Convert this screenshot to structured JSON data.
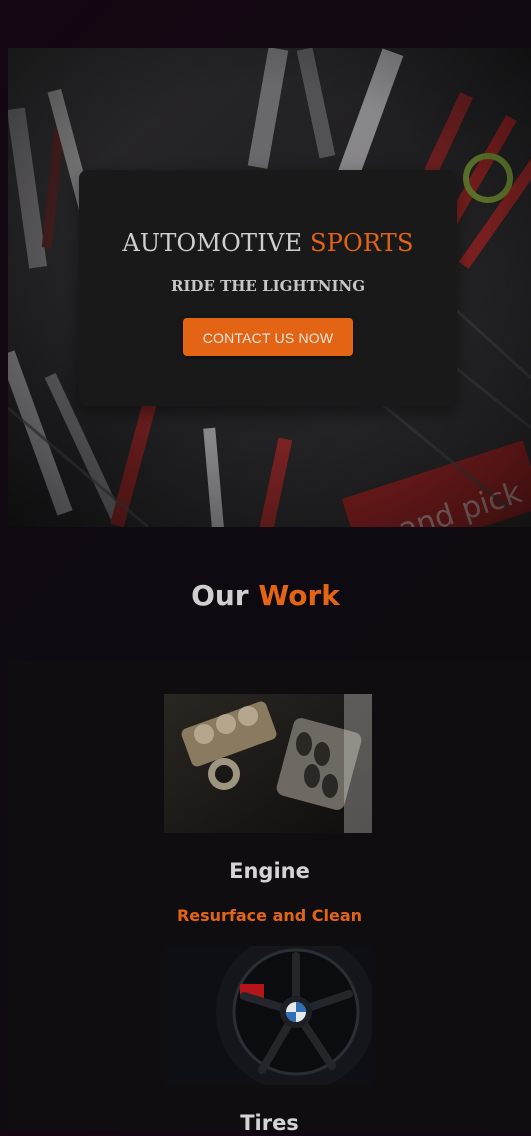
{
  "hero": {
    "title_main": "AUTOMOTIVE",
    "title_accent": "SPORTS",
    "subtitle": "RIDE THE LIGHTNING",
    "cta_label": "CONTACT US NOW",
    "background_image": "tools-workshop-photo"
  },
  "work": {
    "heading_main": "Our",
    "heading_accent": "Work",
    "items": [
      {
        "title": "Engine",
        "subtitle": "Resurface and Clean",
        "image": "engine-photo"
      },
      {
        "title": "Tires",
        "subtitle": "",
        "image": "wheel-photo"
      }
    ]
  },
  "colors": {
    "accent": "#e36415",
    "card_bg": "#191919",
    "panel_bg": "#100d11",
    "text": "#cfcfcf"
  }
}
